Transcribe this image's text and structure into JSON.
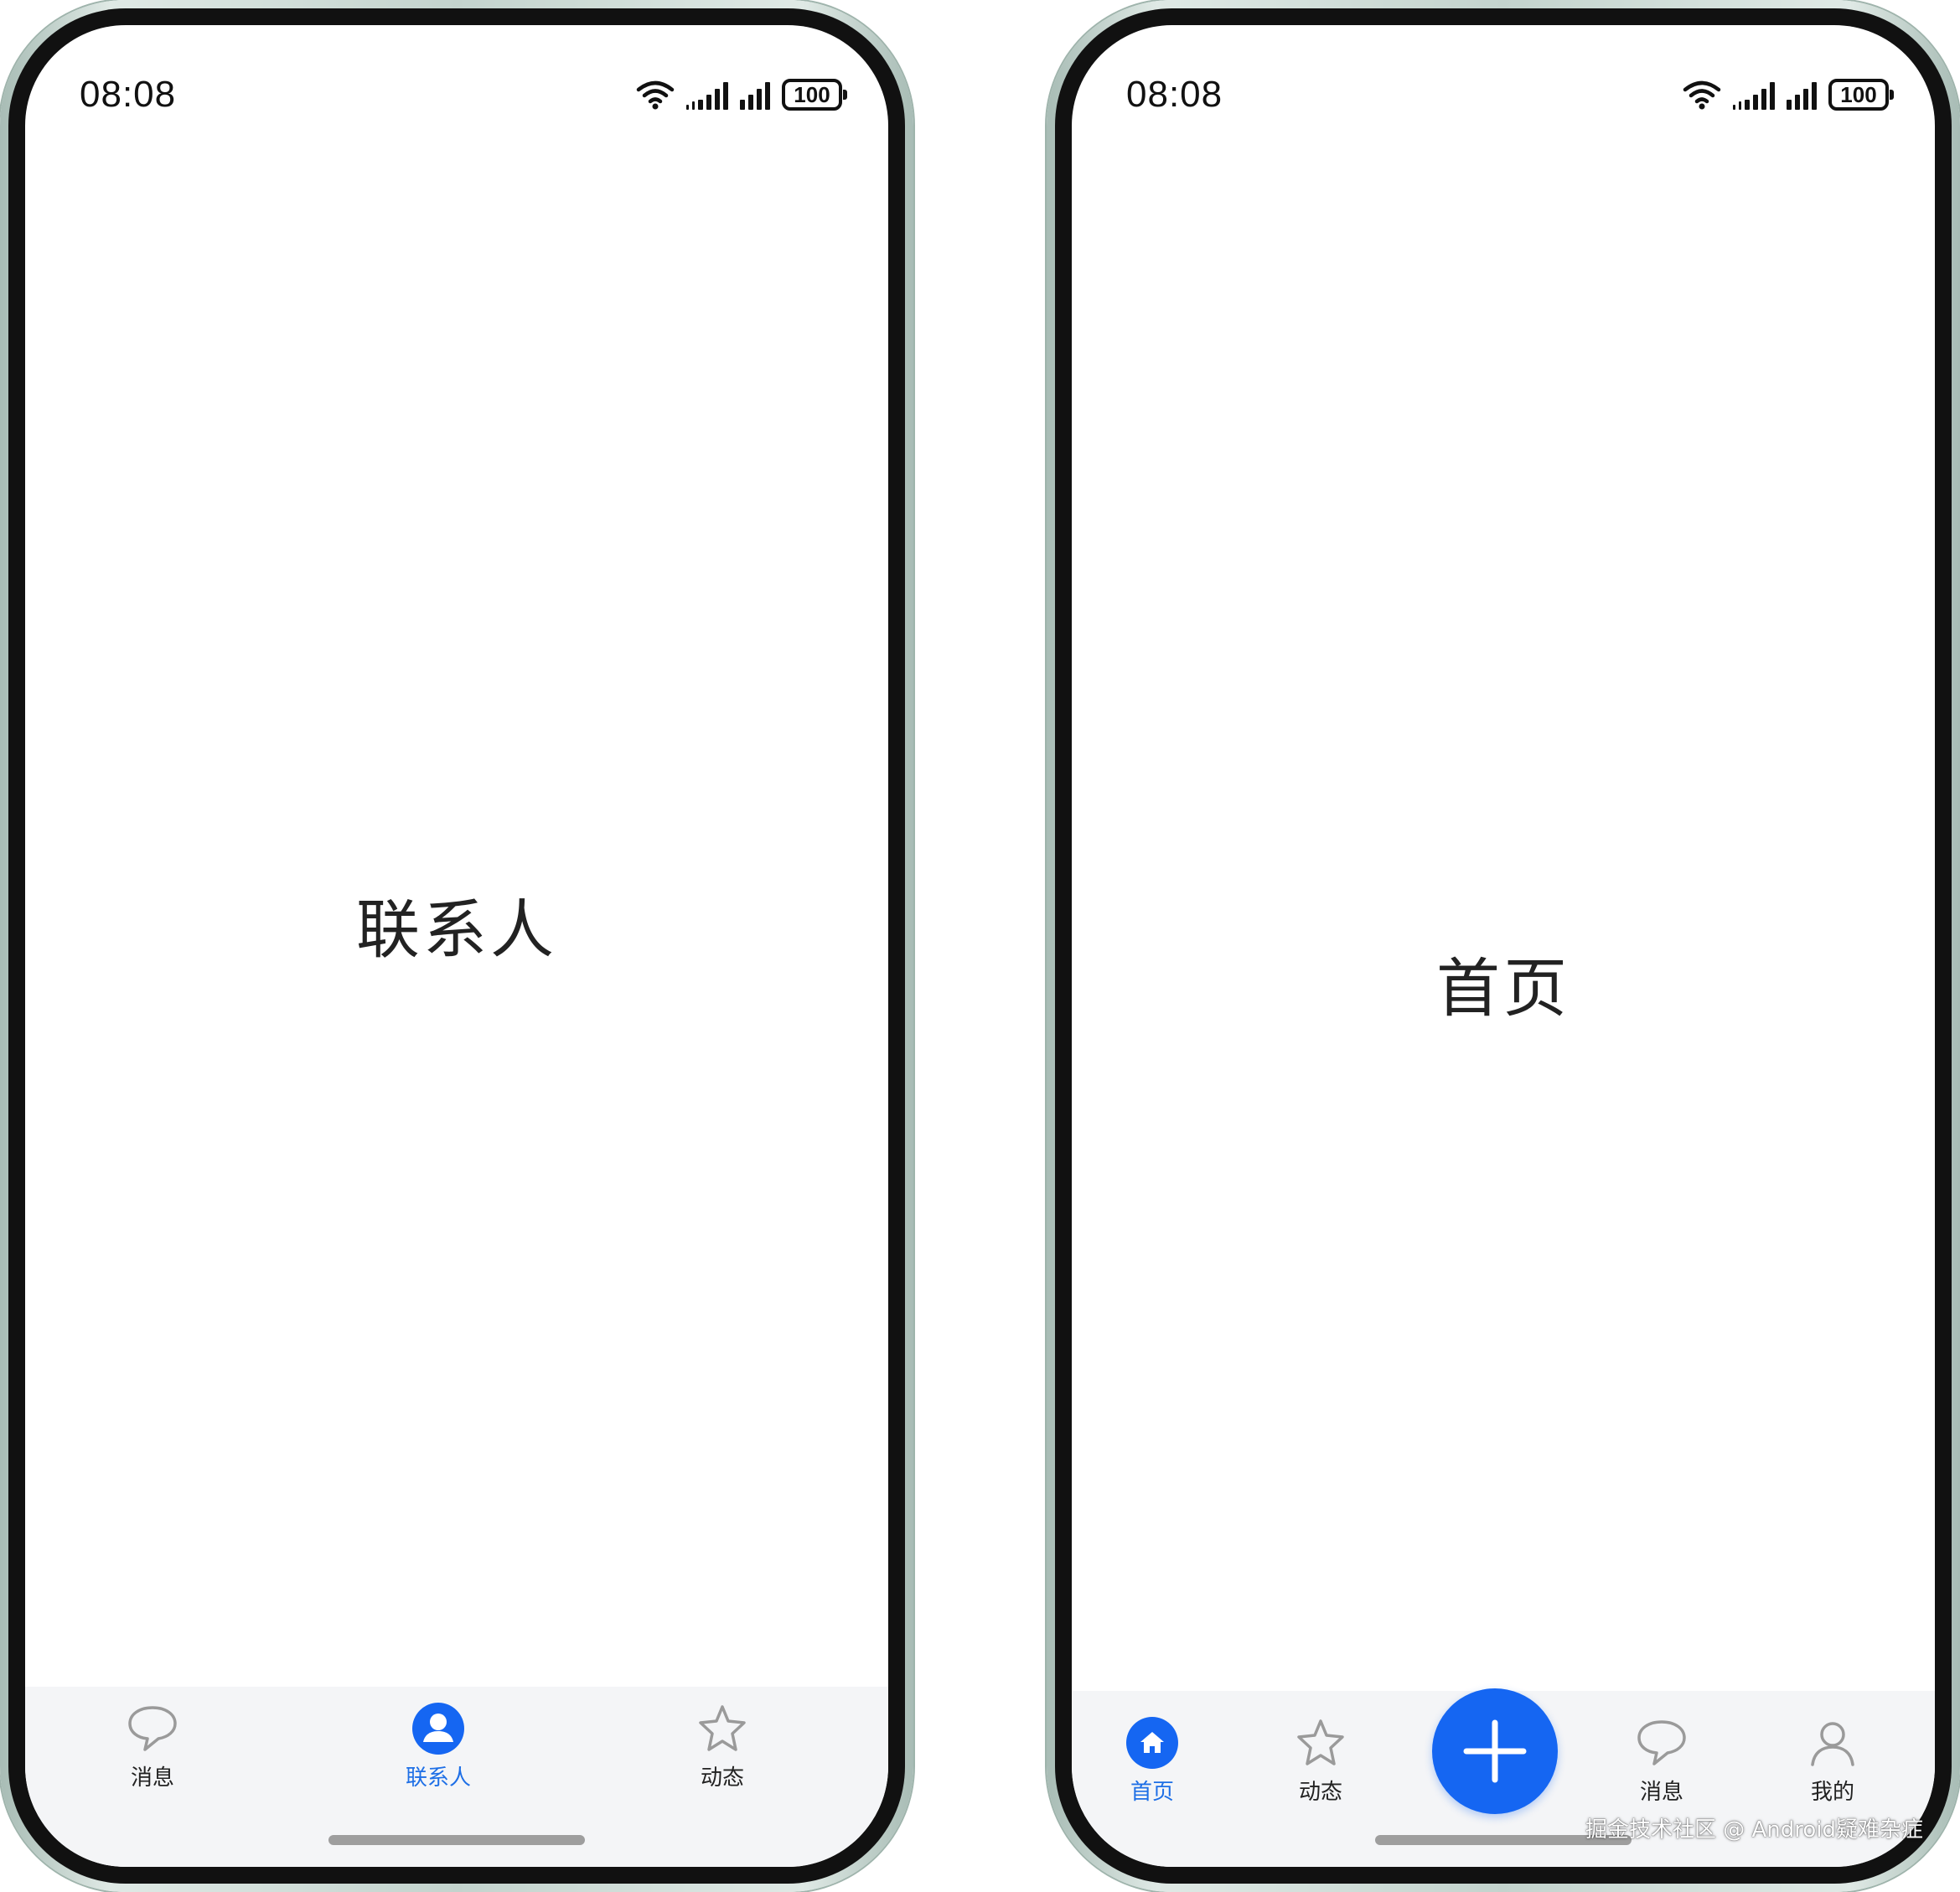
{
  "colors": {
    "accent": "#1566f2",
    "active_label": "#1e6fe6",
    "tabbar_bg": "#f4f5f7"
  },
  "screen1": {
    "status": {
      "time": "08:08",
      "battery": "100"
    },
    "title": "联系人",
    "tabs": [
      {
        "label": "消息",
        "icon": "chat-bubble-icon",
        "active": false
      },
      {
        "label": "联系人",
        "icon": "person-circle-icon",
        "active": true
      },
      {
        "label": "动态",
        "icon": "star-icon",
        "active": false
      }
    ]
  },
  "screen2": {
    "status": {
      "time": "08:08",
      "battery": "100"
    },
    "title": "首页",
    "tabs": [
      {
        "label": "首页",
        "icon": "home-icon",
        "active": true
      },
      {
        "label": "动态",
        "icon": "star-icon",
        "active": false
      },
      {
        "label": "消息",
        "icon": "chat-bubble-icon",
        "active": false
      },
      {
        "label": "我的",
        "icon": "person-icon",
        "active": false
      }
    ],
    "fab_icon": "plus-icon"
  },
  "watermark": "掘金技术社区 @ Android疑难杂症"
}
